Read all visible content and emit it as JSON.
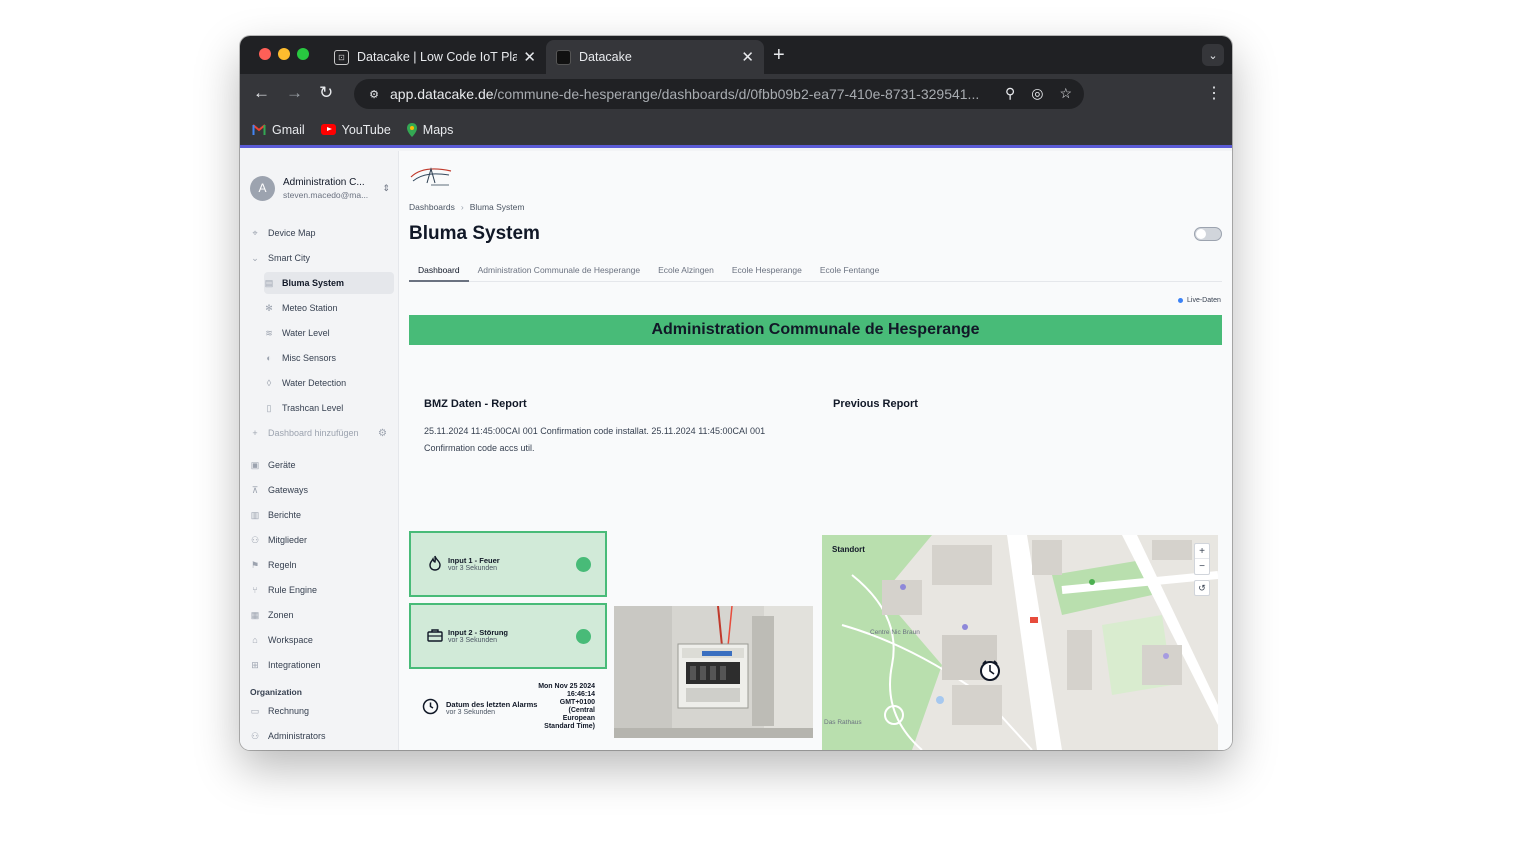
{
  "browser": {
    "tabs": [
      {
        "title": "Datacake | Low Code IoT Plat"
      },
      {
        "title": "Datacake"
      }
    ],
    "url_host": "app.datacake.de",
    "url_path": "/commune-de-hesperange/dashboards/d/0fbb09b2-ea77-410e-8731-329541...",
    "bookmarks": [
      {
        "label": "Gmail",
        "icon": "gmail-icon"
      },
      {
        "label": "YouTube",
        "icon": "youtube-icon"
      },
      {
        "label": "Maps",
        "icon": "maps-icon"
      }
    ]
  },
  "account": {
    "initial": "A",
    "name": "Administration C...",
    "email": "steven.macedo@ma..."
  },
  "sidebar": {
    "items": [
      {
        "label": "Device Map",
        "icon": "map-pin-icon"
      },
      {
        "label": "Smart City",
        "icon": "chevron-down-icon"
      },
      {
        "label": "Bluma System",
        "icon": "dashboard-icon"
      },
      {
        "label": "Meteo Station",
        "icon": "snowflake-icon"
      },
      {
        "label": "Water Level",
        "icon": "water-level-icon"
      },
      {
        "label": "Misc Sensors",
        "icon": "gauge-icon"
      },
      {
        "label": "Water Detection",
        "icon": "drop-icon"
      },
      {
        "label": "Trashcan Level",
        "icon": "trash-icon"
      },
      {
        "label": "Dashboard hinzufügen",
        "icon": "plus-icon"
      },
      {
        "label": "Geräte",
        "icon": "device-icon"
      },
      {
        "label": "Gateways",
        "icon": "antenna-icon"
      },
      {
        "label": "Berichte",
        "icon": "report-icon"
      },
      {
        "label": "Mitglieder",
        "icon": "users-icon"
      },
      {
        "label": "Regeln",
        "icon": "rules-icon"
      },
      {
        "label": "Rule Engine",
        "icon": "branch-icon"
      },
      {
        "label": "Zonen",
        "icon": "zones-icon"
      },
      {
        "label": "Workspace",
        "icon": "workspace-icon"
      },
      {
        "label": "Integrationen",
        "icon": "integrations-icon"
      },
      {
        "label": "Rechnung",
        "icon": "billing-icon"
      },
      {
        "label": "Administrators",
        "icon": "admins-icon"
      }
    ],
    "org_heading": "Organization"
  },
  "main": {
    "breadcrumb": [
      "Dashboards",
      "Bluma System"
    ],
    "title": "Bluma System",
    "tabs": [
      "Dashboard",
      "Administration Communale de Hesperange",
      "Ecole Alzingen",
      "Ecole Hesperange",
      "Ecole Fentange"
    ],
    "live_label": "Live-Daten",
    "banner": "Administration Communale de Hesperange",
    "report": {
      "title": "BMZ Daten - Report",
      "text": "25.11.2024 11:45:00CAI 001 Confirmation code installat. 25.11.2024 11:45:00CAI 001 Confirmation code accs util.",
      "previous_title": "Previous Report"
    },
    "inputs": [
      {
        "title": "Input 1 - Feuer",
        "sub": "vor 3 Sekunden",
        "icon": "flame-icon",
        "status_color": "#48bb78"
      },
      {
        "title": "Input 2 - Störung",
        "sub": "vor 3 Sekunden",
        "icon": "toolbox-icon",
        "status_color": "#48bb78"
      }
    ],
    "alarm": {
      "title": "Datum des letzten Alarms",
      "sub": "vor 3 Sekunden",
      "value": "Mon Nov 25 2024 16:46:14 GMT+0100 (Central European Standard Time)"
    },
    "map": {
      "title": "Standort",
      "labels": [
        "Centre Nic Braun",
        "Das Rathaus"
      ],
      "zoom_in": "+",
      "zoom_out": "−"
    }
  },
  "colors": {
    "accent_green": "#48bb78",
    "card_green_bg": "#d1ead8",
    "bookmark_bar_border": "#5b5bd6"
  }
}
